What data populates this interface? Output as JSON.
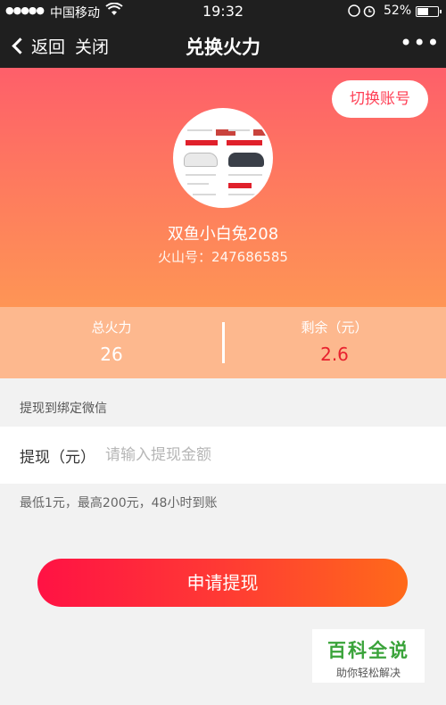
{
  "status_bar": {
    "signal": "●●●●●",
    "carrier": "中国移动",
    "time": "19:32",
    "battery": "52%"
  },
  "nav": {
    "back_label": "返回",
    "close_label": "关闭",
    "title": "兑换火力",
    "more": "•••"
  },
  "profile": {
    "switch_account": "切换账号",
    "name": "双鱼小白兔208",
    "id_text": "火山号：247686585"
  },
  "stats": {
    "total_label": "总火力",
    "total_value": "26",
    "remaining_label": "剩余（元）",
    "remaining_value": "2.6"
  },
  "withdraw": {
    "section_label": "提现到绑定微信",
    "field_label": "提现（元）",
    "placeholder": "请输入提现金额",
    "value": "",
    "note": "最低1元，最高200元，48小时到账",
    "submit": "申请提现"
  },
  "watermark": {
    "big": "百科全说",
    "small": "助你轻松解决"
  },
  "colors": {
    "accent_red": "#e8212e",
    "nav_bg": "#1f1f1f",
    "watermark_green": "#3aa33a"
  }
}
